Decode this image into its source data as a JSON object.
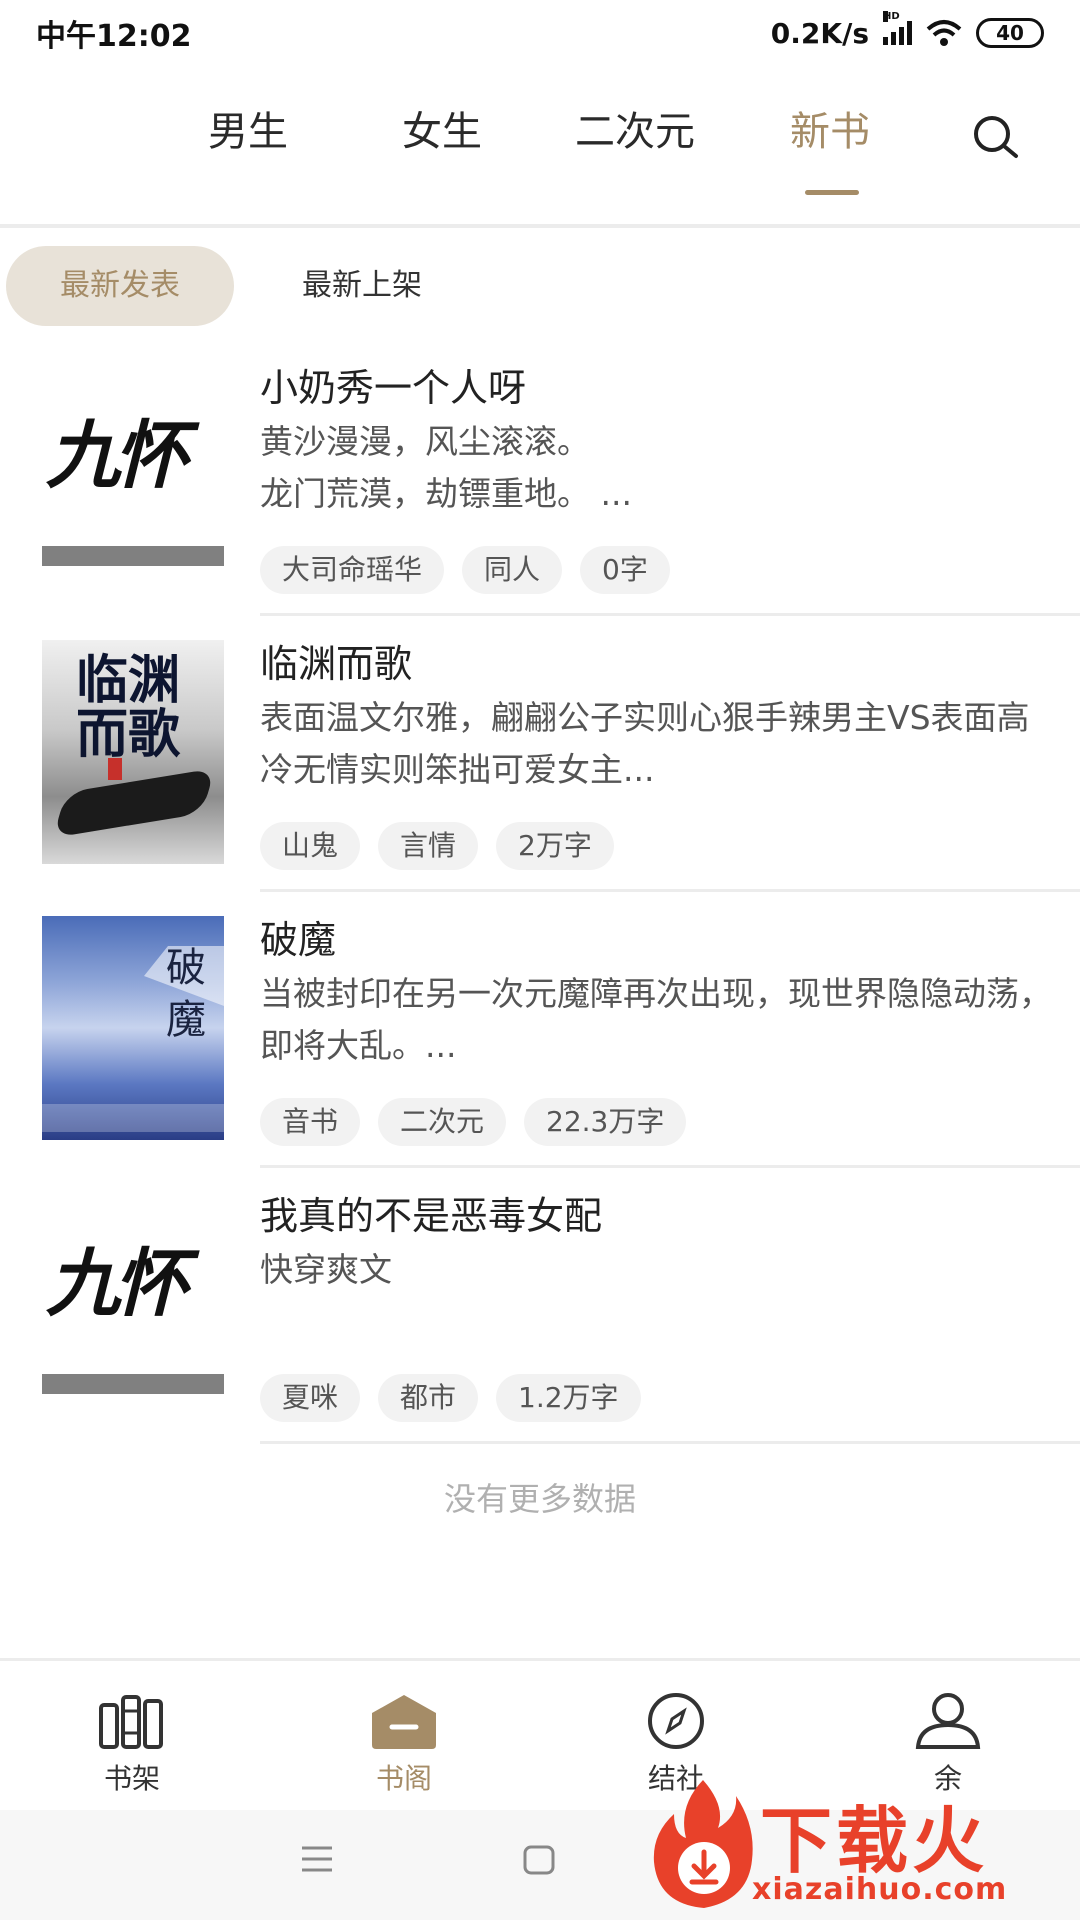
{
  "status_bar": {
    "time": "中午12:02",
    "net_speed": "0.2K/s",
    "signal_badge": "HD",
    "battery": "40"
  },
  "top_tabs": {
    "items": [
      "男生",
      "女生",
      "二次元",
      "新书"
    ],
    "active": "新书"
  },
  "sub_tabs": {
    "active_label": "最新发表",
    "other_label": "最新上架"
  },
  "books": [
    {
      "title": "小奶秀一个人呀",
      "desc": "黄沙漫漫，风尘滚滚。\n龙门荒漠，劫镖重地。 ...",
      "tags": [
        "大司命瑶华",
        "同人",
        "0字"
      ],
      "cover": "default-cover",
      "cover_text": "九怀"
    },
    {
      "title": "临渊而歌",
      "desc": "表面温文尔雅，翩翩公子实则心狠手辣男主VS表面高冷无情实则笨拙可爱女主...",
      "tags": [
        "山鬼",
        "言情",
        "2万字"
      ],
      "cover": "ink-wash-cover",
      "cover_text": "临渊而歌"
    },
    {
      "title": "破魔",
      "desc": "当被封印在另一次元魔障再次出现，现世界隐隐动荡，即将大乱。...",
      "tags": [
        "音书",
        "二次元",
        "22.3万字"
      ],
      "cover": "ice-field-cover",
      "cover_text": "破魔"
    },
    {
      "title": "我真的不是恶毒女配",
      "desc": "快穿爽文",
      "tags": [
        "夏咪",
        "都市",
        "1.2万字"
      ],
      "cover": "default-cover",
      "cover_text": "九怀"
    }
  ],
  "no_more_text": "没有更多数据",
  "bottom_nav": {
    "items": [
      {
        "label": "书架",
        "icon": "bookshelf-icon"
      },
      {
        "label": "书阁",
        "icon": "book-pavilion-icon"
      },
      {
        "label": "结社",
        "icon": "compass-icon"
      },
      {
        "label": "余",
        "icon": "profile-icon"
      }
    ],
    "active": "书阁"
  },
  "watermark": {
    "text": "下载火",
    "url": "xiazaihuo.com"
  },
  "colors": {
    "accent": "#a58c67",
    "subtab_bg": "#e8e2d8",
    "watermark_red": "#e8412a"
  }
}
